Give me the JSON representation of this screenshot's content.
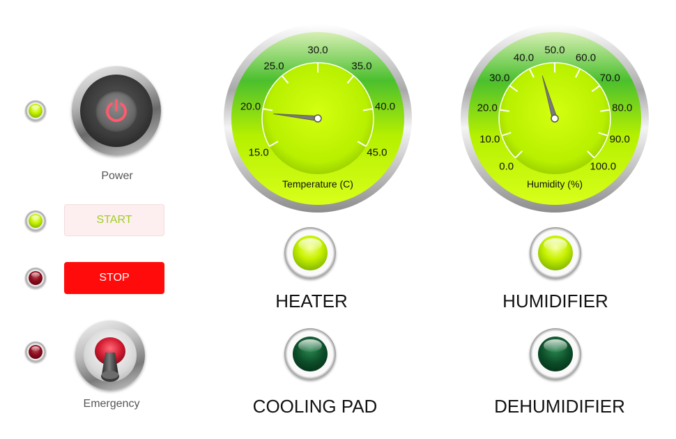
{
  "colors": {
    "lamp_on": "#c7f200",
    "lamp_off_red": "#8a0d1d",
    "lamp_off_green": "#0c4d28",
    "start_text": "#9fce1e",
    "stop_bg": "#ff0b0b",
    "gauge_face": "#b5f000",
    "power_symbol": "#ff5a6e"
  },
  "controls": {
    "power": {
      "label": "Power",
      "icon": "power-icon",
      "lamp_state": "on"
    },
    "start": {
      "label": "START",
      "lamp_state": "on"
    },
    "stop": {
      "label": "STOP",
      "lamp_state": "off"
    },
    "emergency": {
      "label": "Emergency",
      "icon": "toggle-knob-icon",
      "lamp_state": "off"
    }
  },
  "gauges": {
    "temperature": {
      "title": "Temperature (C)",
      "min": 15,
      "max": 45,
      "ticks": [
        "15.0",
        "20.0",
        "25.0",
        "30.0",
        "35.0",
        "40.0",
        "45.0"
      ],
      "value": 19.5
    },
    "humidity": {
      "title": "Humidity (%)",
      "min": 0,
      "max": 100,
      "ticks": [
        "0.0",
        "10.0",
        "20.0",
        "30.0",
        "40.0",
        "50.0",
        "60.0",
        "70.0",
        "80.0",
        "90.0",
        "100.0"
      ],
      "value": 44
    }
  },
  "indicators": {
    "heater": {
      "label": "HEATER",
      "state": "on"
    },
    "cooling_pad": {
      "label": "COOLING PAD",
      "state": "off"
    },
    "humidifier": {
      "label": "HUMIDIFIER",
      "state": "on"
    },
    "dehumidifier": {
      "label": "DEHUMIDIFIER",
      "state": "off"
    }
  }
}
